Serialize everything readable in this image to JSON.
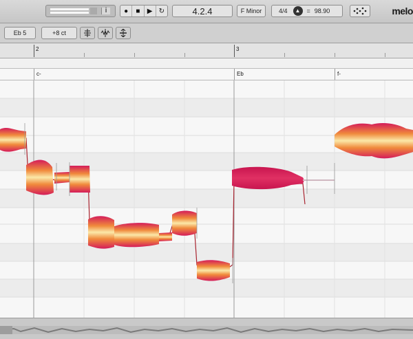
{
  "toolbar": {
    "position_display": "4.2.4",
    "key_display": "F Minor",
    "time_signature": "4/4",
    "tempo": "98.90",
    "logo": "melo",
    "transport": {
      "record": "●",
      "stop": "■",
      "play": "▶",
      "loop": "↻"
    }
  },
  "toolbar2": {
    "note_value": "Eb 5",
    "cents_value": "+8 ct"
  },
  "ruler": {
    "bar2": "2",
    "bar3": "3"
  },
  "chords": {
    "c1": "c-",
    "c2": "Eb",
    "c3": "f-"
  },
  "colors": {
    "blob_hot": "#d41c5a",
    "blob_mid": "#f08a3c",
    "blob_light": "#fbe8a8",
    "pitch_line": "#a8232f"
  }
}
